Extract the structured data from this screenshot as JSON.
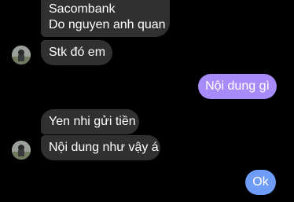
{
  "colors": {
    "background": "#000000",
    "incoming_bubble": "#303030",
    "outgoing_purple": "#a78bfa",
    "outgoing_blue": "#6f9cf7"
  },
  "messages": [
    {
      "direction": "incoming",
      "lines": [
        "Sacombank",
        "Do nguyen anh quan"
      ]
    },
    {
      "direction": "incoming",
      "lines": [
        "Stk đó em"
      ],
      "avatar": "contact-avatar"
    },
    {
      "direction": "outgoing",
      "lines": [
        "Nội dung gì"
      ]
    },
    {
      "direction": "incoming",
      "lines": [
        "Yen nhi gửi tiền"
      ]
    },
    {
      "direction": "incoming",
      "lines": [
        "Nội dung như vậy á"
      ],
      "avatar": "contact-avatar"
    },
    {
      "direction": "outgoing",
      "lines": [
        "Ok"
      ]
    }
  ]
}
